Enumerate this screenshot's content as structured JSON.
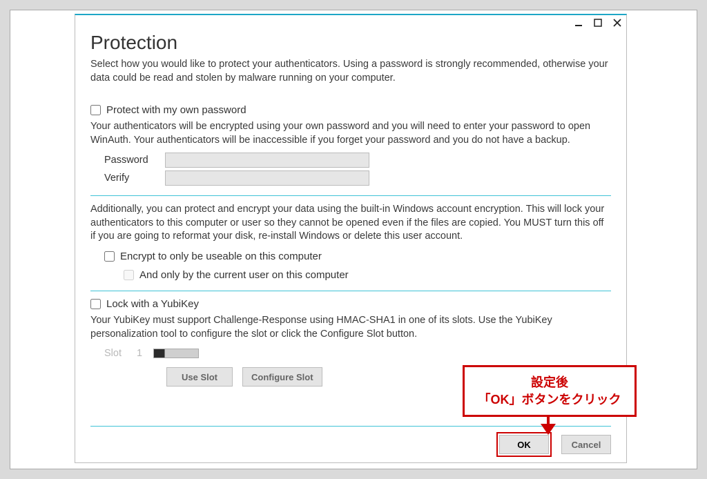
{
  "window": {
    "title": "Protection",
    "intro": "Select how you would like to protect your authenticators. Using a password is strongly recommended, otherwise your data could be read and stolen by malware running on your computer."
  },
  "protect": {
    "label": "Protect with my own password",
    "desc": "Your authenticators will be encrypted using your own password and you will need to enter your password to open WinAuth. Your authenticators will be inaccessible if you forget your password and you do not have a backup.",
    "password_label": "Password",
    "verify_label": "Verify",
    "password_value": "",
    "verify_value": ""
  },
  "encrypt": {
    "desc": "Additionally, you can protect and encrypt your data using the built-in Windows account encryption. This will lock your authenticators to this computer or user so they cannot be opened even if the files are copied. You MUST turn this off if you are going to reformat your disk, re-install Windows or delete this user account.",
    "label1": "Encrypt to only be useable on this computer",
    "label2": "And only by the current user on this computer"
  },
  "yubikey": {
    "label": "Lock with a YubiKey",
    "desc": "Your YubiKey must support Challenge-Response using HMAC-SHA1 in one of its slots. Use the YubiKey personalization tool to configure the slot or click the Configure Slot button.",
    "slot_label": "Slot",
    "slot_value": "1",
    "use_slot": "Use Slot",
    "configure_slot": "Configure Slot"
  },
  "buttons": {
    "ok": "OK",
    "cancel": "Cancel"
  },
  "annotation": {
    "line1": "設定後",
    "line2": "「OK」ボタンをクリック"
  }
}
